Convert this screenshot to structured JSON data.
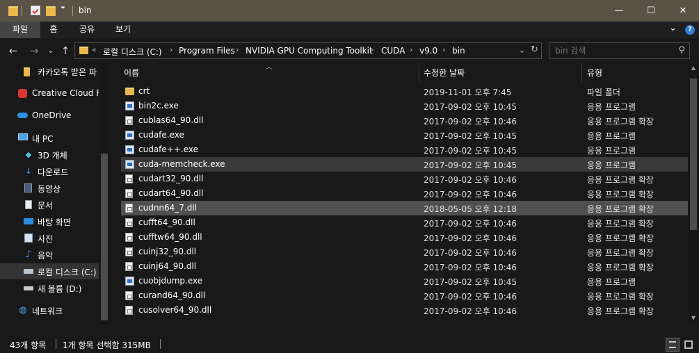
{
  "window": {
    "title": "bin",
    "minimize_glyph": "—",
    "maximize_glyph": "☐",
    "close_glyph": "✕"
  },
  "ribbon": {
    "tabs": [
      "파일",
      "홈",
      "공유",
      "보기"
    ],
    "expand_glyph": "⌄",
    "help_glyph": "?"
  },
  "nav": {
    "back_glyph": "←",
    "forward_glyph": "→",
    "recent_glyph": "⌄",
    "up_glyph": "↑",
    "overflow": "«",
    "breadcrumbs": [
      "로컬 디스크 (C:)",
      "Program Files",
      "NVIDIA GPU Computing Toolkit",
      "CUDA",
      "v9.0",
      "bin"
    ],
    "dropdown_glyph": "⌄",
    "refresh_glyph": "↻",
    "search_placeholder": "bin 검색",
    "search_glyph": "⚲"
  },
  "sidebar": {
    "items": [
      {
        "label": "카카오톡 받은 파",
        "icon": "folder-icon",
        "indent": 1
      },
      {
        "label": "Creative Cloud Fil",
        "icon": "creative-cloud-icon",
        "indent": 0
      },
      {
        "label": "OneDrive",
        "icon": "onedrive-icon",
        "indent": 0
      },
      {
        "label": "내 PC",
        "icon": "computer-icon",
        "indent": 0
      },
      {
        "label": "3D 개체",
        "icon": "3d-objects-icon",
        "indent": 1
      },
      {
        "label": "다운로드",
        "icon": "downloads-icon",
        "indent": 1
      },
      {
        "label": "동영상",
        "icon": "videos-icon",
        "indent": 1
      },
      {
        "label": "문서",
        "icon": "documents-icon",
        "indent": 1
      },
      {
        "label": "바탕 화면",
        "icon": "desktop-icon",
        "indent": 1
      },
      {
        "label": "사진",
        "icon": "pictures-icon",
        "indent": 1
      },
      {
        "label": "음악",
        "icon": "music-icon",
        "indent": 1
      },
      {
        "label": "로컬 디스크 (C:)",
        "icon": "local-disk-icon",
        "indent": 1
      },
      {
        "label": "새 볼륨 (D:)",
        "icon": "drive-icon",
        "indent": 1
      },
      {
        "label": "네트워크",
        "icon": "network-icon",
        "indent": 0
      }
    ]
  },
  "columns": {
    "name": "이름",
    "date": "수정한 날짜",
    "type": "유형"
  },
  "files": [
    {
      "name": "crt",
      "date": "2019-11-01 오후 7:45",
      "type": "파일 폴더",
      "kind": "folder"
    },
    {
      "name": "bin2c.exe",
      "date": "2017-09-02 오후 10:45",
      "type": "응용 프로그램",
      "kind": "exe"
    },
    {
      "name": "cublas64_90.dll",
      "date": "2017-09-02 오후 10:46",
      "type": "응용 프로그램 확장",
      "kind": "dll"
    },
    {
      "name": "cudafe.exe",
      "date": "2017-09-02 오후 10:45",
      "type": "응용 프로그램",
      "kind": "exe"
    },
    {
      "name": "cudafe++.exe",
      "date": "2017-09-02 오후 10:45",
      "type": "응용 프로그램",
      "kind": "exe"
    },
    {
      "name": "cuda-memcheck.exe",
      "date": "2017-09-02 오후 10:45",
      "type": "응용 프로그램",
      "kind": "exe"
    },
    {
      "name": "cudart32_90.dll",
      "date": "2017-09-02 오후 10:46",
      "type": "응용 프로그램 확장",
      "kind": "dll"
    },
    {
      "name": "cudart64_90.dll",
      "date": "2017-09-02 오후 10:46",
      "type": "응용 프로그램 확장",
      "kind": "dll"
    },
    {
      "name": "cudnn64_7.dll",
      "date": "2018-05-05 오후 12:18",
      "type": "응용 프로그램 확장",
      "kind": "dll"
    },
    {
      "name": "cufft64_90.dll",
      "date": "2017-09-02 오후 10:46",
      "type": "응용 프로그램 확장",
      "kind": "dll"
    },
    {
      "name": "cufftw64_90.dll",
      "date": "2017-09-02 오후 10:46",
      "type": "응용 프로그램 확장",
      "kind": "dll"
    },
    {
      "name": "cuinj32_90.dll",
      "date": "2017-09-02 오후 10:46",
      "type": "응용 프로그램 확장",
      "kind": "dll"
    },
    {
      "name": "cuinj64_90.dll",
      "date": "2017-09-02 오후 10:46",
      "type": "응용 프로그램 확장",
      "kind": "dll"
    },
    {
      "name": "cuobjdump.exe",
      "date": "2017-09-02 오후 10:45",
      "type": "응용 프로그램",
      "kind": "exe"
    },
    {
      "name": "curand64_90.dll",
      "date": "2017-09-02 오후 10:46",
      "type": "응용 프로그램 확장",
      "kind": "dll"
    },
    {
      "name": "cusolver64_90.dll",
      "date": "2017-09-02 오후 10:46",
      "type": "응용 프로그램 확장",
      "kind": "dll"
    }
  ],
  "status": {
    "item_count": "43개 항목",
    "selection": "1개 항목 선택함 315MB"
  }
}
